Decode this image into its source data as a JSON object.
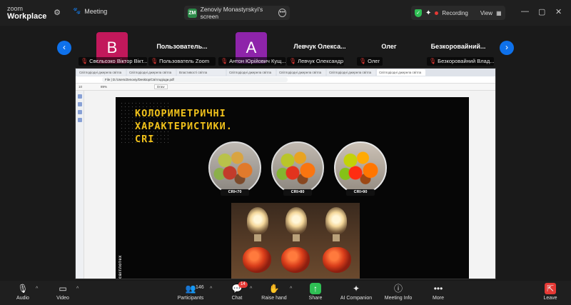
{
  "app": {
    "brand_top": "zoom",
    "brand_bottom": "Workplace"
  },
  "topbar": {
    "meeting_label": "Meeting",
    "screen_owner_initials": "ZM",
    "screen_label": "Zenoviy Monastyrskyi's screen",
    "recording_label": "Recording",
    "view_label": "View",
    "accent": "#0e71eb",
    "recording_color": "#e53935"
  },
  "participants": [
    {
      "initial": "B",
      "color": "#c2185b",
      "label": "Свєльозко Віктор Вікт..."
    },
    {
      "display_name": "Пользователь...",
      "label": "Пользователь Zoom"
    },
    {
      "initial": "А",
      "color": "#8e24aa",
      "label": "Антон Юрійович Кущ..."
    },
    {
      "display_name": "Левчук  Олекса...",
      "label": "Левчук Олександр"
    },
    {
      "display_name": "Олег",
      "label": "Олег"
    },
    {
      "display_name": "Безкоровайний...",
      "label": "Безкоровайний Влад..."
    }
  ],
  "shared_screen": {
    "tabs": [
      "Світлодіодні джерела світла",
      "Світлодіодні джерела світла",
      "Властивості світла",
      "Світлодіодні джерела світла",
      "Світлодіодні джерела світла",
      "Світлодіодні джерела світла",
      "Світлодіодні джерела світла"
    ],
    "url": "File | D:/Users/Zenoviy/Desktop/Світлодіоди.pdf",
    "zoom": "89%",
    "pdf_page": "10",
    "draw_label": "Draw",
    "slide": {
      "title_line1": "КОЛОРИМЕТРИЧНІ",
      "title_line2": "ХАРАКТЕРИСТИКИ.",
      "title_line3": "CRI",
      "cri_labels": [
        "CRI<70",
        "CRI>80",
        "CRI>90"
      ],
      "logo_text": "світлотех"
    }
  },
  "toolbar": {
    "audio": "Audio",
    "video": "Video",
    "participants": "Participants",
    "participants_count": "146",
    "chat": "Chat",
    "chat_badge": "14",
    "raise_hand": "Raise hand",
    "share": "Share",
    "ai_companion": "AI Companion",
    "meeting_info": "Meeting Info",
    "more": "More",
    "leave": "Leave"
  }
}
